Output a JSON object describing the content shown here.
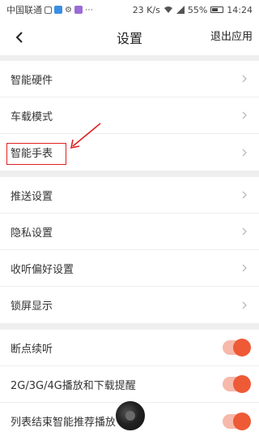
{
  "status_bar": {
    "carrier": "中国联通",
    "speed": "23 K/s",
    "battery": "55%",
    "battery_level": 0.55,
    "time": "14:24"
  },
  "nav": {
    "title": "设置",
    "logout_label": "退出应用"
  },
  "groups": [
    {
      "items": [
        {
          "label": "智能硬件"
        },
        {
          "label": "车载模式"
        },
        {
          "label": "智能手表"
        }
      ]
    },
    {
      "items": [
        {
          "label": "推送设置"
        },
        {
          "label": "隐私设置"
        },
        {
          "label": "收听偏好设置"
        },
        {
          "label": "锁屏显示"
        }
      ]
    },
    {
      "items": [
        {
          "label": "断点续听",
          "toggle": true
        },
        {
          "label": "2G/3G/4G播放和下载提醒",
          "toggle": true
        },
        {
          "label": "列表结束智能推荐播放",
          "toggle": true
        }
      ]
    }
  ],
  "colors": {
    "accent": "#ee5a36",
    "highlight": "#e02020"
  }
}
